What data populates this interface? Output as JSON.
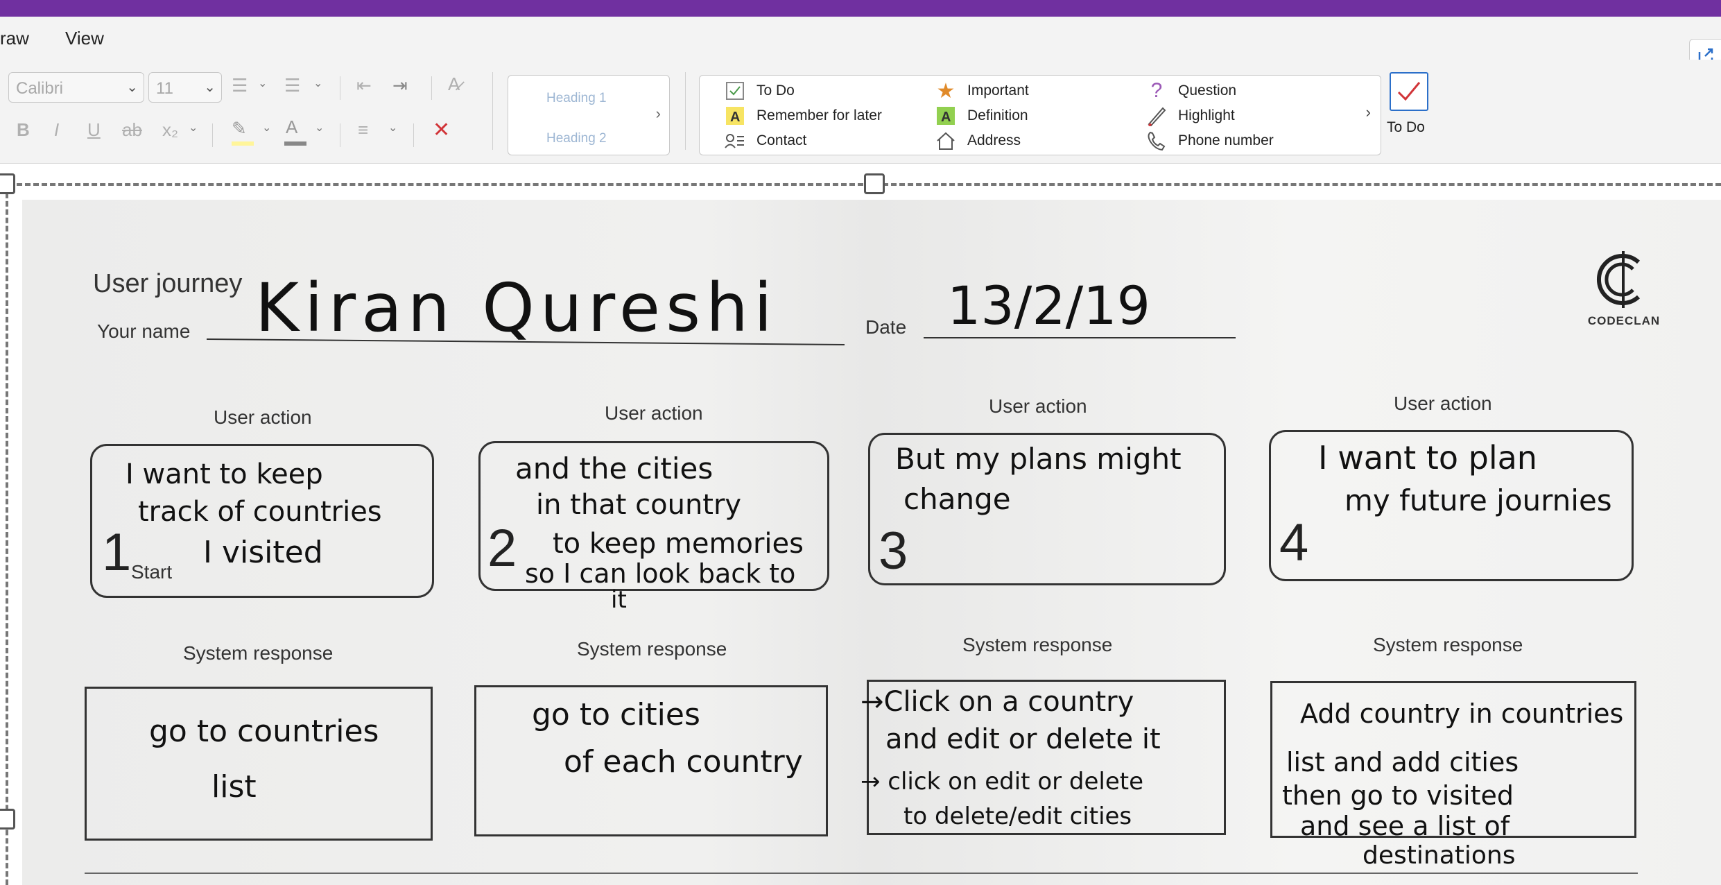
{
  "menu": {
    "draw": "raw",
    "view": "View"
  },
  "ribbon": {
    "font_name": "Calibri",
    "font_size": "11",
    "styles": {
      "h1": "Heading 1",
      "h2": "Heading 2"
    },
    "tags": [
      {
        "label": "To Do",
        "icon": "checkbox-icon"
      },
      {
        "label": "Remember for later",
        "icon": "highlight-a-icon"
      },
      {
        "label": "Contact",
        "icon": "contact-card-icon"
      },
      {
        "label": "Important",
        "icon": "star-icon"
      },
      {
        "label": "Definition",
        "icon": "green-a-icon"
      },
      {
        "label": "Address",
        "icon": "house-icon"
      },
      {
        "label": "Question",
        "icon": "question-icon"
      },
      {
        "label": "Highlight",
        "icon": "pen-icon"
      },
      {
        "label": "Phone number",
        "icon": "phone-icon"
      }
    ],
    "todo_button": "To Do"
  },
  "doc": {
    "title": "User journey",
    "your_name_label": "Your name",
    "name": "Kiran Qureshi",
    "date_label": "Date",
    "date": "13/2/19",
    "logo": "CODECLAN",
    "user_action_label": "User action",
    "system_response_label": "System response",
    "start_label": "Start",
    "steps": [
      {
        "num": "1",
        "action": [
          "I want to keep",
          "track of countries",
          "I visited"
        ],
        "response": [
          "go to countries",
          "list"
        ]
      },
      {
        "num": "2",
        "action": [
          "and the cities",
          "in that country",
          "to keep memories",
          "so I can look back to",
          "it"
        ],
        "response": [
          "go to cities",
          "of each country"
        ]
      },
      {
        "num": "3",
        "action": [
          "But my plans might",
          "change"
        ],
        "response": [
          "→Click on a country",
          "and edit or delete it",
          "→ click on edit or delete",
          "to delete/edit cities"
        ]
      },
      {
        "num": "4",
        "action": [
          "I want to plan",
          "my future journies"
        ],
        "response": [
          "Add country in countries",
          "list and add cities",
          "then go to visited",
          "and see a list of",
          "destinations"
        ]
      }
    ]
  },
  "colors": {
    "accent": "#7030a0",
    "todo_check": "#d13438"
  }
}
